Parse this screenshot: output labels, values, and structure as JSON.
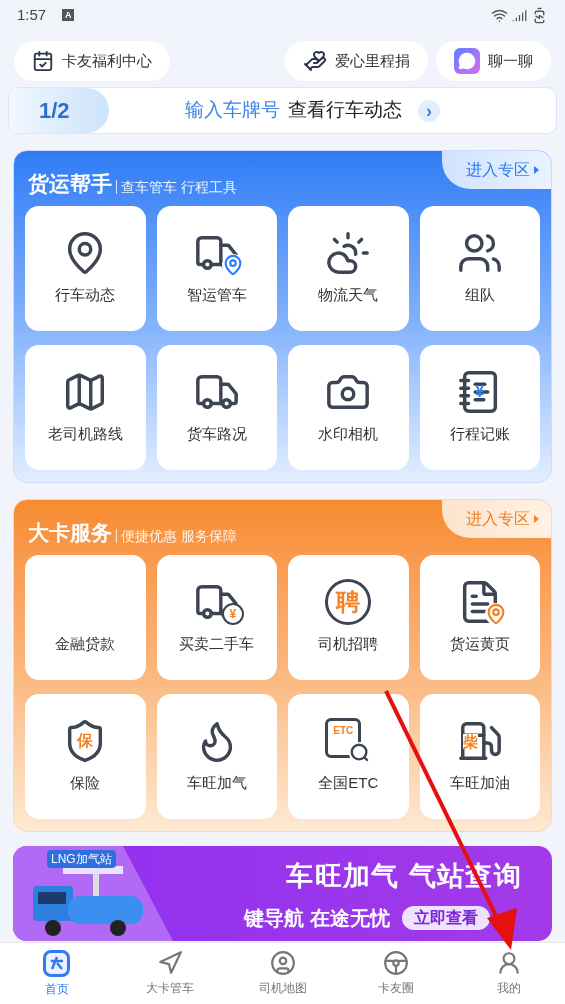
{
  "status_bar": {
    "time": "1:57",
    "badge": "A"
  },
  "top_pills": [
    {
      "label": "卡友福利中心",
      "kind": "calendar"
    },
    {
      "label": "爱心里程捐",
      "kind": "heart"
    },
    {
      "label": "聊一聊",
      "kind": "chat"
    }
  ],
  "plate_banner": {
    "page": "1/2",
    "highlight": "输入车牌号",
    "text": "查看行车动态",
    "arrow": "›"
  },
  "sections": [
    {
      "title": "货运帮手",
      "subtitle": "查车管车 行程工具",
      "link": "进入专区",
      "tiles": [
        {
          "label": "行车动态",
          "kind": "pin"
        },
        {
          "label": "智运管车",
          "kind": "truck-pin"
        },
        {
          "label": "物流天气",
          "kind": "weather"
        },
        {
          "label": "组队",
          "kind": "team"
        },
        {
          "label": "老司机路线",
          "kind": "map"
        },
        {
          "label": "货车路况",
          "kind": "road"
        },
        {
          "label": "水印相机",
          "kind": "camera"
        },
        {
          "label": "行程记账",
          "kind": "ledger",
          "glyph": "¥"
        }
      ]
    },
    {
      "title": "大卡服务",
      "subtitle": "便捷优惠 服务保障",
      "link": "进入专区",
      "tiles": [
        {
          "label": "金融贷款",
          "kind": "none"
        },
        {
          "label": "买卖二手车",
          "kind": "truck-coin",
          "glyph": "¥"
        },
        {
          "label": "司机招聘",
          "kind": "circle-glyph",
          "glyph": "聘"
        },
        {
          "label": "货运黄页",
          "kind": "doc-pin"
        },
        {
          "label": "保险",
          "kind": "shield",
          "glyph": "保"
        },
        {
          "label": "车旺加气",
          "kind": "flame"
        },
        {
          "label": "全国ETC",
          "kind": "etc",
          "glyph": "ETC"
        },
        {
          "label": "车旺加油",
          "kind": "pump",
          "glyph": "柴"
        }
      ]
    }
  ],
  "promo": {
    "sign": "LNG加气站",
    "title": "车旺加气 气站查询",
    "subtitle": "键导航 在途无忧",
    "button": "立即查看"
  },
  "tab_bar": [
    {
      "label": "首页",
      "selected": true
    },
    {
      "label": "大卡管车",
      "selected": false
    },
    {
      "label": "司机地图",
      "selected": false
    },
    {
      "label": "卡友圈",
      "selected": false
    },
    {
      "label": "我的",
      "selected": false
    }
  ]
}
